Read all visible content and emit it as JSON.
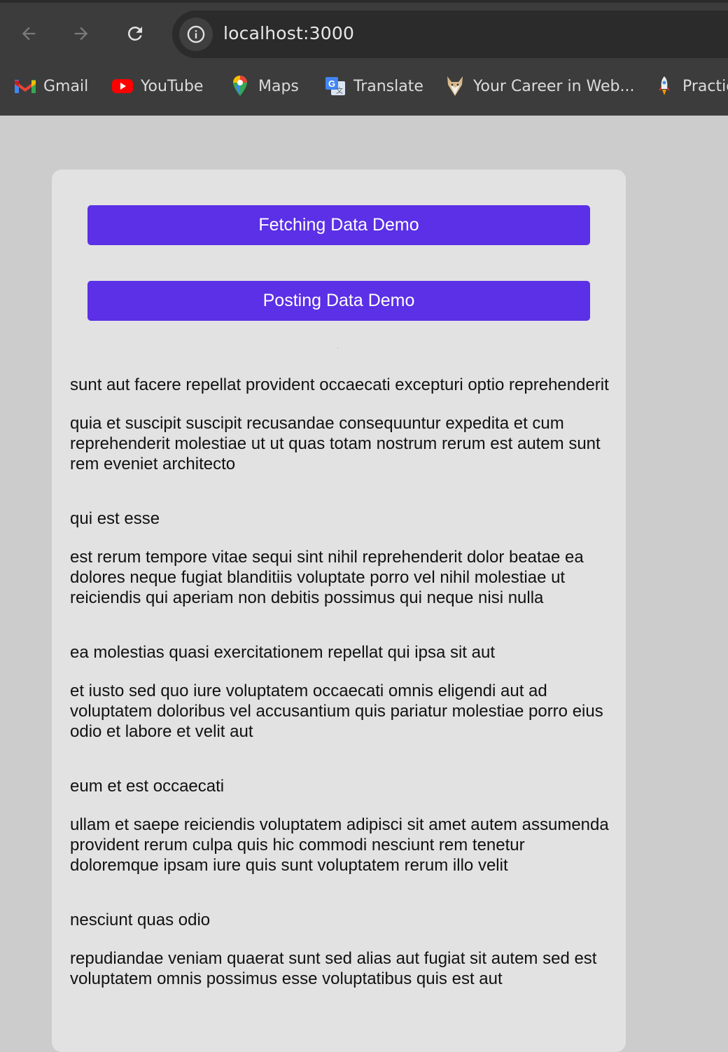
{
  "browser": {
    "url": "localhost:3000",
    "nav_icons": [
      "back-arrow-icon",
      "forward-arrow-icon",
      "reload-icon"
    ],
    "bookmarks": [
      {
        "label": "Gmail",
        "icon": "gmail-icon"
      },
      {
        "label": "YouTube",
        "icon": "youtube-icon"
      },
      {
        "label": "Maps",
        "icon": "maps-icon"
      },
      {
        "label": "Translate",
        "icon": "translate-icon"
      },
      {
        "label": "Your Career in Web...",
        "icon": "fox-icon"
      },
      {
        "label": "Practic",
        "icon": "rocket-icon"
      }
    ]
  },
  "colors": {
    "chrome_bg": "#3c3c3c",
    "page_bg": "#cccccc",
    "card_bg": "#e2e2e2",
    "button_bg": "#5b30e6"
  },
  "buttons": {
    "fetch_label": "Fetching Data Demo",
    "post_label": "Posting Data Demo"
  },
  "posts": [
    {
      "title": "sunt aut facere repellat provident occaecati excepturi optio reprehenderit",
      "body": "quia et suscipit suscipit recusandae consequuntur expedita et cum reprehenderit molestiae ut ut quas totam nostrum rerum est autem sunt rem eveniet architecto"
    },
    {
      "title": "qui est esse",
      "body": "est rerum tempore vitae sequi sint nihil reprehenderit dolor beatae ea dolores neque fugiat blanditiis voluptate porro vel nihil molestiae ut reiciendis qui aperiam non debitis possimus qui neque nisi nulla"
    },
    {
      "title": "ea molestias quasi exercitationem repellat qui ipsa sit aut",
      "body": "et iusto sed quo iure voluptatem occaecati omnis eligendi aut ad voluptatem doloribus vel accusantium quis pariatur molestiae porro eius odio et labore et velit aut"
    },
    {
      "title": "eum et est occaecati",
      "body": "ullam et saepe reiciendis voluptatem adipisci sit amet autem assumenda provident rerum culpa quis hic commodi nesciunt rem tenetur doloremque ipsam iure quis sunt voluptatem rerum illo velit"
    },
    {
      "title": "nesciunt quas odio",
      "body": "repudiandae veniam quaerat sunt sed alias aut fugiat sit autem sed est voluptatem omnis possimus esse voluptatibus quis est aut"
    }
  ]
}
